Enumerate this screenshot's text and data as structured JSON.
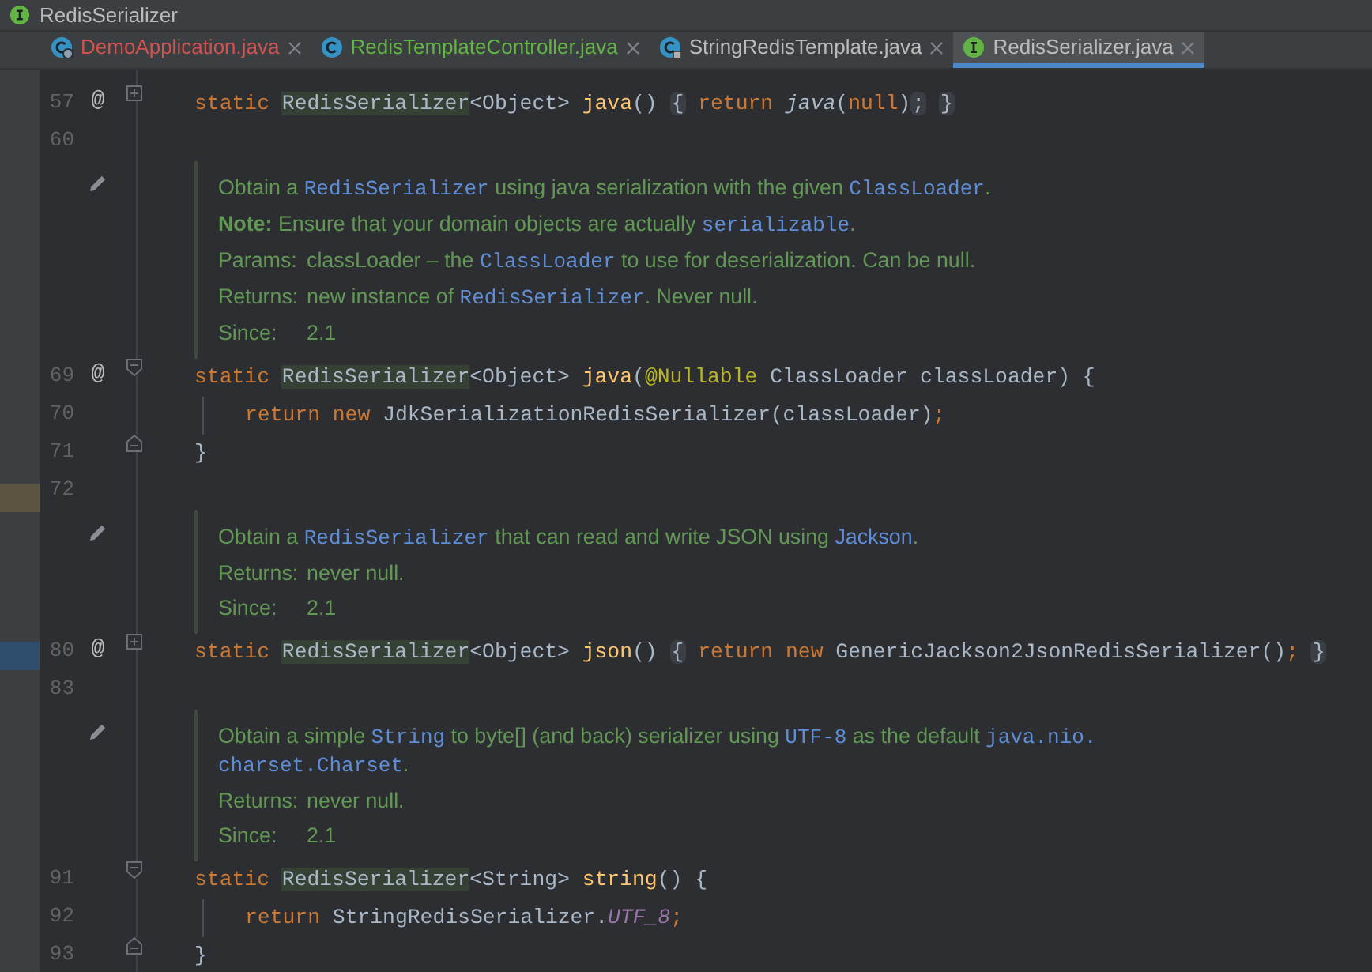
{
  "breadcrumb": {
    "label": "RedisSerializer"
  },
  "tabs": [
    {
      "label": "DemoApplication.java",
      "kind": "app",
      "color": "#d25252",
      "selected": false
    },
    {
      "label": "RedisTemplateController.java",
      "kind": "class",
      "color": "#62b543",
      "selected": false
    },
    {
      "label": "StringRedisTemplate.java",
      "kind": "locked-class",
      "color": "#bbbbbb",
      "selected": false
    },
    {
      "label": "RedisSerializer.java",
      "kind": "interface",
      "color": "#bbbbbb",
      "selected": true
    }
  ],
  "editor": {
    "lines": [
      {
        "kind": "code",
        "number": "57",
        "marker": "@",
        "fold": {
          "kind": "collapsed"
        },
        "tokens": [
          {
            "kind": "kw",
            "text": "static "
          },
          {
            "kind": "type",
            "text": "RedisSerializer"
          },
          {
            "kind": "plain",
            "text": "<Object> "
          },
          {
            "kind": "fn",
            "text": "java"
          },
          {
            "kind": "plain",
            "text": "() "
          },
          {
            "kind": "folded",
            "text": "{"
          },
          {
            "kind": "kw",
            "text": " return "
          },
          {
            "kind": "call",
            "text": "java"
          },
          {
            "kind": "plain",
            "text": "("
          },
          {
            "kind": "kw",
            "text": "null"
          },
          {
            "kind": "plain",
            "text": ")"
          },
          {
            "kind": "folded",
            "text": ";"
          },
          {
            "kind": "folded-end",
            "text": "}"
          }
        ]
      },
      {
        "kind": "code",
        "number": "60"
      },
      {
        "kind": "doc",
        "paragraphs": [
          {
            "segments": [
              {
                "kind": "text",
                "text": "Obtain a "
              },
              {
                "kind": "code",
                "text": "RedisSerializer"
              },
              {
                "kind": "text",
                "text": " using java serialization with the given "
              },
              {
                "kind": "code",
                "text": "ClassLoader"
              },
              {
                "kind": "text",
                "text": "."
              }
            ]
          },
          {
            "segments": [
              {
                "kind": "bold",
                "text": "Note:"
              },
              {
                "kind": "text",
                "text": " Ensure that your domain objects are actually "
              },
              {
                "kind": "code",
                "text": "serializable"
              },
              {
                "kind": "text",
                "text": "."
              }
            ]
          }
        ],
        "tags": [
          {
            "label": "Params:",
            "segments": [
              {
                "kind": "text",
                "text": "classLoader – the "
              },
              {
                "kind": "code",
                "text": "ClassLoader"
              },
              {
                "kind": "text",
                "text": " to use for deserialization. Can be null."
              }
            ]
          },
          {
            "label": "Returns:",
            "segments": [
              {
                "kind": "text",
                "text": "new instance of "
              },
              {
                "kind": "code",
                "text": "RedisSerializer"
              },
              {
                "kind": "text",
                "text": ". Never null."
              }
            ]
          },
          {
            "label": "Since:",
            "segments": [
              {
                "kind": "text",
                "text": "2.1"
              }
            ]
          }
        ]
      },
      {
        "kind": "code",
        "number": "69",
        "marker": "@",
        "fold": {
          "kind": "start"
        },
        "tokens": [
          {
            "kind": "kw",
            "text": "static "
          },
          {
            "kind": "type",
            "text": "RedisSerializer"
          },
          {
            "kind": "plain",
            "text": "<Object> "
          },
          {
            "kind": "fn",
            "text": "java"
          },
          {
            "kind": "plain",
            "text": "("
          },
          {
            "kind": "anno",
            "text": "@Nullable"
          },
          {
            "kind": "plain",
            "text": " ClassLoader classLoader) {"
          }
        ]
      },
      {
        "kind": "code",
        "number": "70",
        "indented": true,
        "tokens": [
          {
            "kind": "kw",
            "text": "return new "
          },
          {
            "kind": "plain",
            "text": "JdkSerializationRedisSerializer(classLoader)"
          },
          {
            "kind": "kw",
            "text": ";"
          }
        ]
      },
      {
        "kind": "code",
        "number": "71",
        "fold": {
          "kind": "end"
        },
        "tokens": [
          {
            "kind": "plain",
            "text": "}"
          }
        ]
      },
      {
        "kind": "code",
        "number": "72"
      },
      {
        "kind": "doc",
        "paragraphs": [
          {
            "segments": [
              {
                "kind": "text",
                "text": "Obtain a "
              },
              {
                "kind": "code",
                "text": "RedisSerializer"
              },
              {
                "kind": "text",
                "text": " that can read and write JSON using "
              },
              {
                "kind": "link",
                "text": "Jackson"
              },
              {
                "kind": "text",
                "text": "."
              }
            ]
          }
        ],
        "tags": [
          {
            "label": "Returns:",
            "segments": [
              {
                "kind": "text",
                "text": "never null."
              }
            ]
          },
          {
            "label": "Since:",
            "segments": [
              {
                "kind": "text",
                "text": "2.1"
              }
            ]
          }
        ]
      },
      {
        "kind": "code",
        "number": "80",
        "marker": "@",
        "fold": {
          "kind": "collapsed"
        },
        "tokens": [
          {
            "kind": "kw",
            "text": "static "
          },
          {
            "kind": "type",
            "text": "RedisSerializer"
          },
          {
            "kind": "plain",
            "text": "<Object> "
          },
          {
            "kind": "fn",
            "text": "json"
          },
          {
            "kind": "plain",
            "text": "() "
          },
          {
            "kind": "folded",
            "text": "{"
          },
          {
            "kind": "kw",
            "text": " return new "
          },
          {
            "kind": "plain",
            "text": "GenericJackson2JsonRedisSerializer()"
          },
          {
            "kind": "kw",
            "text": ";"
          },
          {
            "kind": "folded-end",
            "text": "}"
          }
        ]
      },
      {
        "kind": "code",
        "number": "83"
      },
      {
        "kind": "doc",
        "paragraphs": [
          {
            "segments": [
              {
                "kind": "text",
                "text": "Obtain a simple "
              },
              {
                "kind": "code",
                "text": "String"
              },
              {
                "kind": "text",
                "text": " to byte[] (and back) serializer using "
              },
              {
                "kind": "code",
                "text": "UTF-8"
              },
              {
                "kind": "text",
                "text": " as the default "
              },
              {
                "kind": "code",
                "text": "java.nio."
              },
              {
                "kind": "code",
                "text": "charset.Charset"
              },
              {
                "kind": "text",
                "text": "."
              }
            ]
          }
        ],
        "tags": [
          {
            "label": "Returns:",
            "segments": [
              {
                "kind": "text",
                "text": "never null."
              }
            ]
          },
          {
            "label": "Since:",
            "segments": [
              {
                "kind": "text",
                "text": "2.1"
              }
            ]
          }
        ]
      },
      {
        "kind": "code",
        "number": "91",
        "fold": {
          "kind": "start"
        },
        "tokens": [
          {
            "kind": "kw",
            "text": "static "
          },
          {
            "kind": "type",
            "text": "RedisSerializer"
          },
          {
            "kind": "plain",
            "text": "<String> "
          },
          {
            "kind": "fn",
            "text": "string"
          },
          {
            "kind": "plain",
            "text": "() {"
          }
        ]
      },
      {
        "kind": "code",
        "number": "92",
        "indented": true,
        "tokens": [
          {
            "kind": "kw",
            "text": "return "
          },
          {
            "kind": "plain",
            "text": "StringRedisSerializer."
          },
          {
            "kind": "const",
            "text": "UTF_8"
          },
          {
            "kind": "kw",
            "text": ";"
          }
        ]
      },
      {
        "kind": "code",
        "number": "93",
        "fold": {
          "kind": "end"
        },
        "tokens": [
          {
            "kind": "plain",
            "text": "}"
          }
        ]
      }
    ]
  }
}
